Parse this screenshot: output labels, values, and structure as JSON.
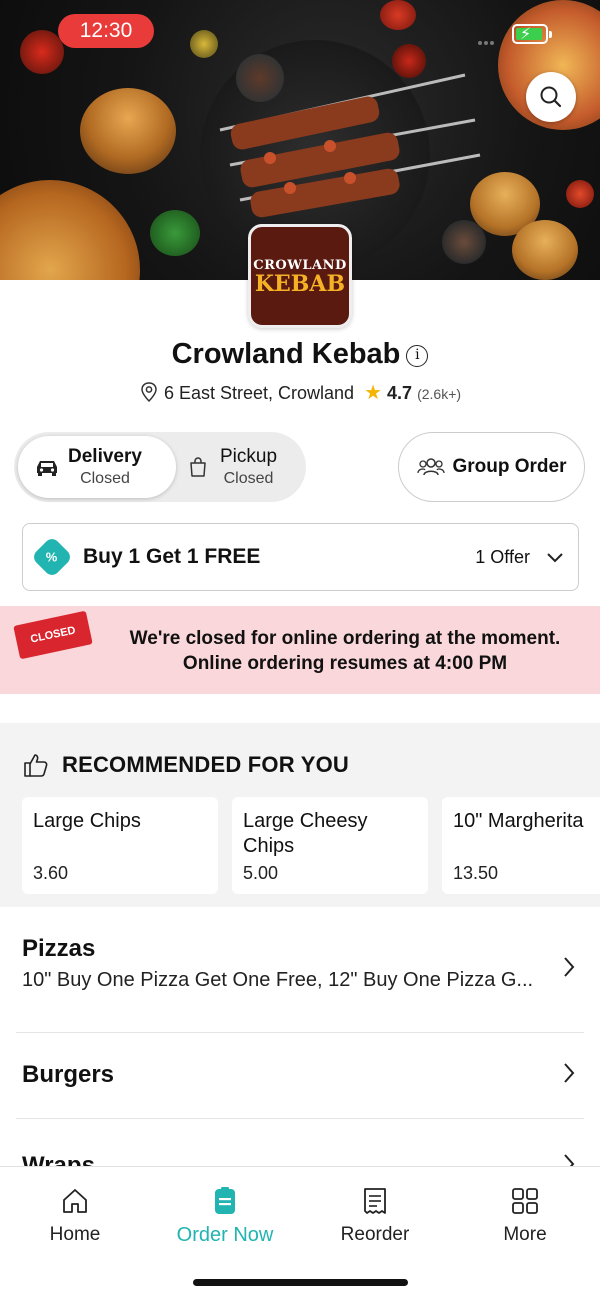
{
  "status_bar": {
    "time": "12:30"
  },
  "store": {
    "logo_line1": "CROWLAND",
    "logo_line2": "KEBAB",
    "name": "Crowland Kebab",
    "address": "6 East Street, Crowland",
    "rating": "4.7",
    "rating_count": "(2.6k+)"
  },
  "order_modes": {
    "delivery": {
      "label": "Delivery",
      "status": "Closed"
    },
    "pickup": {
      "label": "Pickup",
      "status": "Closed"
    },
    "group_order_label": "Group Order"
  },
  "offer": {
    "badge": "%",
    "title": "Buy 1 Get 1 FREE",
    "count": "1 Offer"
  },
  "closed_notice": {
    "sign": "CLOSED",
    "line1": "We're closed for online ordering at the moment.",
    "line2": "Online ordering resumes at 4:00 PM"
  },
  "recommended": {
    "title": "RECOMMENDED FOR YOU",
    "items": [
      {
        "name": "Large Chips",
        "price": "3.60"
      },
      {
        "name": "Large Cheesy Chips",
        "price": "5.00"
      },
      {
        "name": "10\" Margherita",
        "price": "13.50"
      }
    ]
  },
  "categories": [
    {
      "name": "Pizzas",
      "desc": "10\" Buy One Pizza Get One Free, 12\" Buy One Pizza G..."
    },
    {
      "name": "Burgers",
      "desc": ""
    },
    {
      "name": "Wraps",
      "desc": ""
    }
  ],
  "bottom_nav": [
    {
      "label": "Home",
      "icon": "home-icon"
    },
    {
      "label": "Order Now",
      "icon": "order-icon"
    },
    {
      "label": "Reorder",
      "icon": "receipt-icon"
    },
    {
      "label": "More",
      "icon": "grid-icon"
    }
  ],
  "colors": {
    "accent": "#21b4b0",
    "closed_banner": "#f9d7da",
    "time_pill": "#ea3b3b",
    "star": "#f5b400"
  }
}
